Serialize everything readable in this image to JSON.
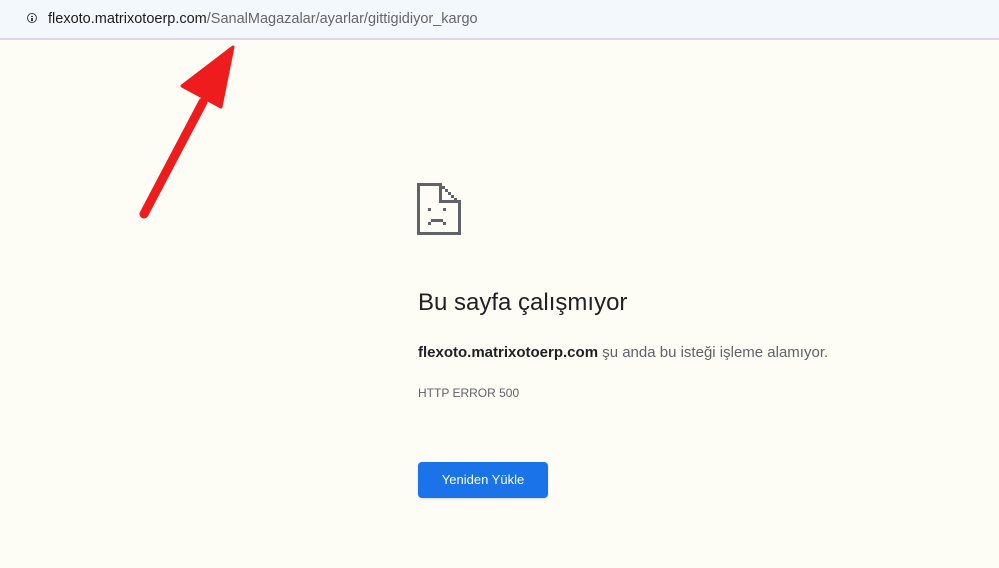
{
  "address_bar": {
    "host": "flexoto.matrixotoerp.com",
    "path": "/SanalMagazalar/ayarlar/gittigidiyor_kargo",
    "icon": "info-icon"
  },
  "annotation": {
    "icon": "red-arrow-icon",
    "color": "#ee1c1c"
  },
  "error": {
    "icon": "sad-file-icon",
    "title": "Bu sayfa çalışmıyor",
    "host": "flexoto.matrixotoerp.com",
    "message": " şu anda bu isteği işleme alamıyor.",
    "code": "HTTP ERROR 500",
    "reload_label": "Yeniden Yükle"
  },
  "colors": {
    "page_background": "#fefdf5",
    "address_background": "#f2f8fb",
    "button": "#1a73e8"
  }
}
